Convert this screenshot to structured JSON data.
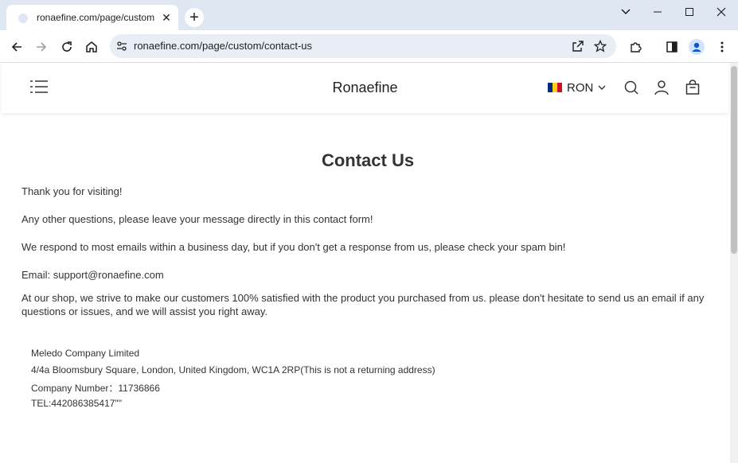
{
  "browser": {
    "tab_title": "ronaefine.com/page/custom/co",
    "tab_close": "✕",
    "new_tab": "+",
    "url": "ronaefine.com/page/custom/contact-us"
  },
  "site": {
    "brand": "Ronaefine",
    "currency": "RON",
    "flag_colors": [
      "#002b7f",
      "#fcd116",
      "#ce1126"
    ]
  },
  "page": {
    "title": "Contact Us",
    "paragraphs": [
      "Thank you for visiting!",
      "Any other questions, please leave your message directly in this contact form!",
      "We respond to most emails within a business day, but if you don't get a response from us, please check your spam bin!",
      "Email: support@ronaefine.com",
      "At our shop, we strive to make our customers 100% satisfied with the product you purchased from us. please don't hesitate to send us an email if any questions or issues, and we will assist you right away."
    ],
    "address": {
      "company": "Meledo Company Limited",
      "street": "4/4a Bloomsbury Square, London, United Kingdom, WC1A 2RP(This is not a returning address)",
      "company_number": "Company Number：11736866",
      "tel": "TEL:442086385417\"\""
    }
  },
  "icons": [
    "favicon-icon",
    "close-icon",
    "plus-icon",
    "chevron-down-icon",
    "minimize-icon",
    "maximize-icon",
    "window-close-icon",
    "back-icon",
    "forward-icon",
    "reload-icon",
    "home-icon",
    "site-info-icon",
    "share-icon",
    "star-icon",
    "extensions-icon",
    "side-panel-icon",
    "profile-icon",
    "menu-icon",
    "hamburger-icon",
    "search-icon",
    "account-icon",
    "cart-icon"
  ]
}
